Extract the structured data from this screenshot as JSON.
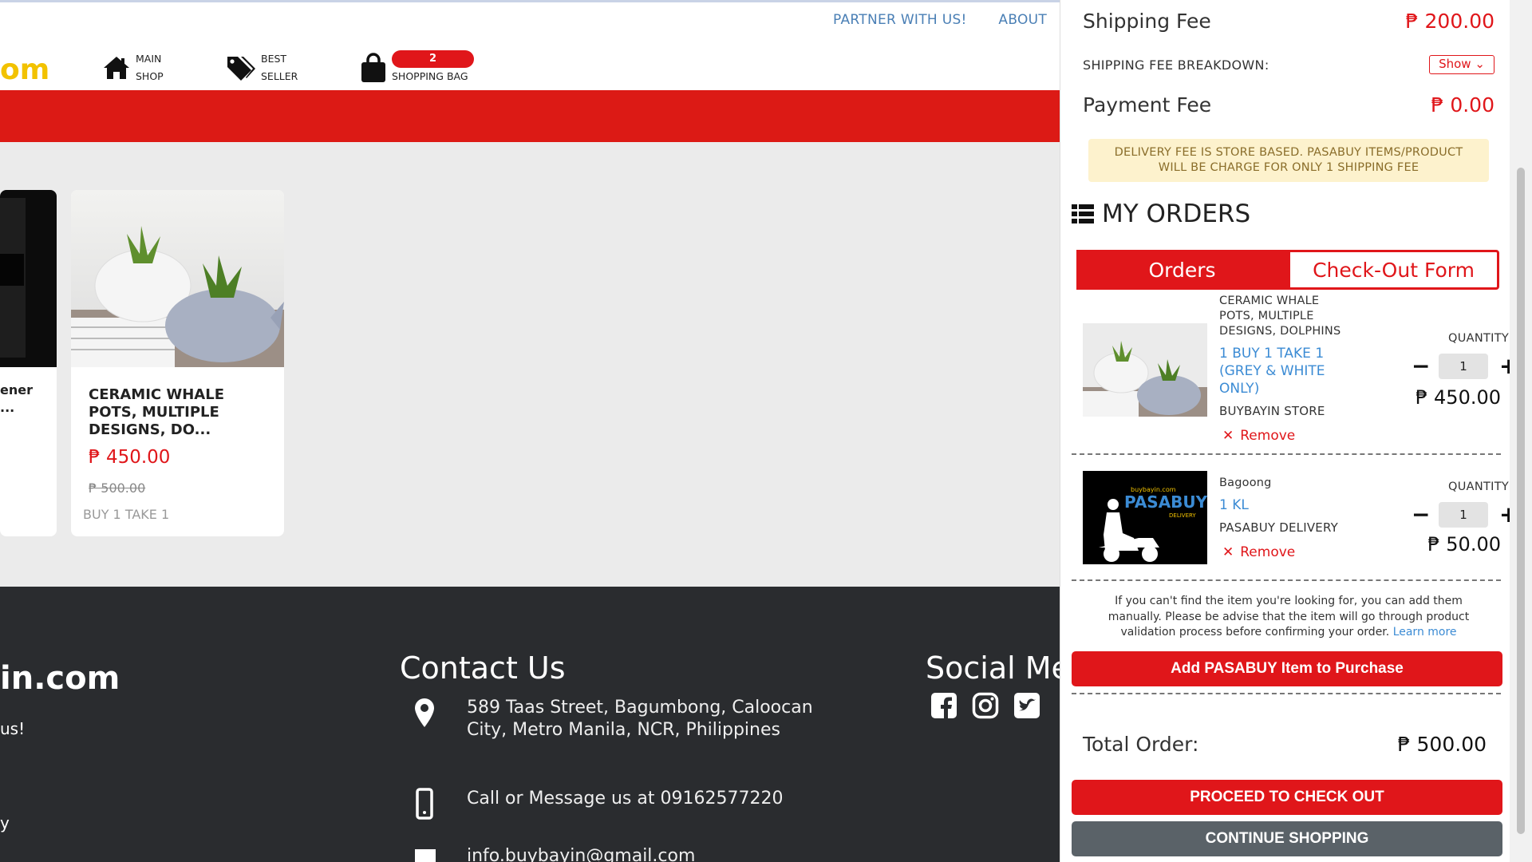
{
  "header": {
    "links": [
      "PARTNER WITH US!",
      "ABOUT"
    ],
    "logo_fragment": "om",
    "nav": [
      {
        "line1": "MAIN",
        "line2": "SHOP"
      },
      {
        "line1": "BEST",
        "line2": "SELLER"
      }
    ],
    "bag": {
      "count": "2",
      "label": "SHOPPING BAG"
    }
  },
  "products": [
    {
      "title_line1": "ener",
      "title_line2": "..."
    },
    {
      "title": "CERAMIC WHALE POTS, MULTIPLE DESIGNS, DO...",
      "price": "₱ 450.00",
      "old_price": "₱ 500.00",
      "promo": "BUY 1 TAKE 1"
    }
  ],
  "footer": {
    "brand": "in.com",
    "tagline": "us!",
    "stray": "y",
    "contact_title": "Contact Us",
    "address_line1": "589 Taas Street, Bagumbong, Caloocan",
    "address_line2": "City, Metro Manila, NCR, Philippines",
    "phone": "Call or Message us at 09162577220",
    "email": "info.buybayin@gmail.com",
    "social_title": "Social Me"
  },
  "cart": {
    "shipping_fee_label": "Shipping Fee",
    "shipping_fee_value": "₱ 200.00",
    "breakdown_label": "SHIPPING FEE BREAKDOWN:",
    "breakdown_select": "Show",
    "payment_fee_label": "Payment Fee",
    "payment_fee_value": "₱ 0.00",
    "notice_line1": "DELIVERY FEE IS STORE BASED. PASABUY ITEMS/PRODUCT",
    "notice_line2": "WILL BE CHARGE FOR ONLY 1 SHIPPING FEE",
    "my_orders": "MY ORDERS",
    "tabs": [
      "Orders",
      "Check-Out Form"
    ],
    "items": [
      {
        "name": "CERAMIC WHALE POTS, MULTIPLE DESIGNS, DOLPHINS",
        "variant": "1 BUY 1 TAKE 1 (GREY & WHITE ONLY)",
        "store": "BUYBAYIN STORE",
        "remove": "Remove",
        "qty_label": "QUANTITY",
        "qty": "1",
        "price": "₱ 450.00"
      },
      {
        "name": "Bagoong",
        "variant": "1 KL",
        "store": "PASABUY DELIVERY",
        "remove": "Remove",
        "qty_label": "QUANTITY",
        "qty": "1",
        "price": "₱ 50.00",
        "logo_small": "buybayin.com",
        "logo_main": "PASABUY",
        "logo_sub": "DELIVERY"
      }
    ],
    "help_line1": "If you can't find the item you're looking for, you can add them",
    "help_line2": "manually. Please be advise that the item will go through product",
    "help_line3": "validation process before confirming your order.",
    "learn_more": "Learn more",
    "add_pasabuy": "Add PASABUY Item to Purchase",
    "total_label": "Total Order:",
    "total_value": "₱ 500.00",
    "checkout": "PROCEED TO CHECK OUT",
    "continue": "CONTINUE SHOPPING"
  },
  "colors": {
    "accent": "#e0161a",
    "footer_bg": "#2a2c2f",
    "notice_bg": "#fdf2cd",
    "link": "#3b8bd4"
  }
}
